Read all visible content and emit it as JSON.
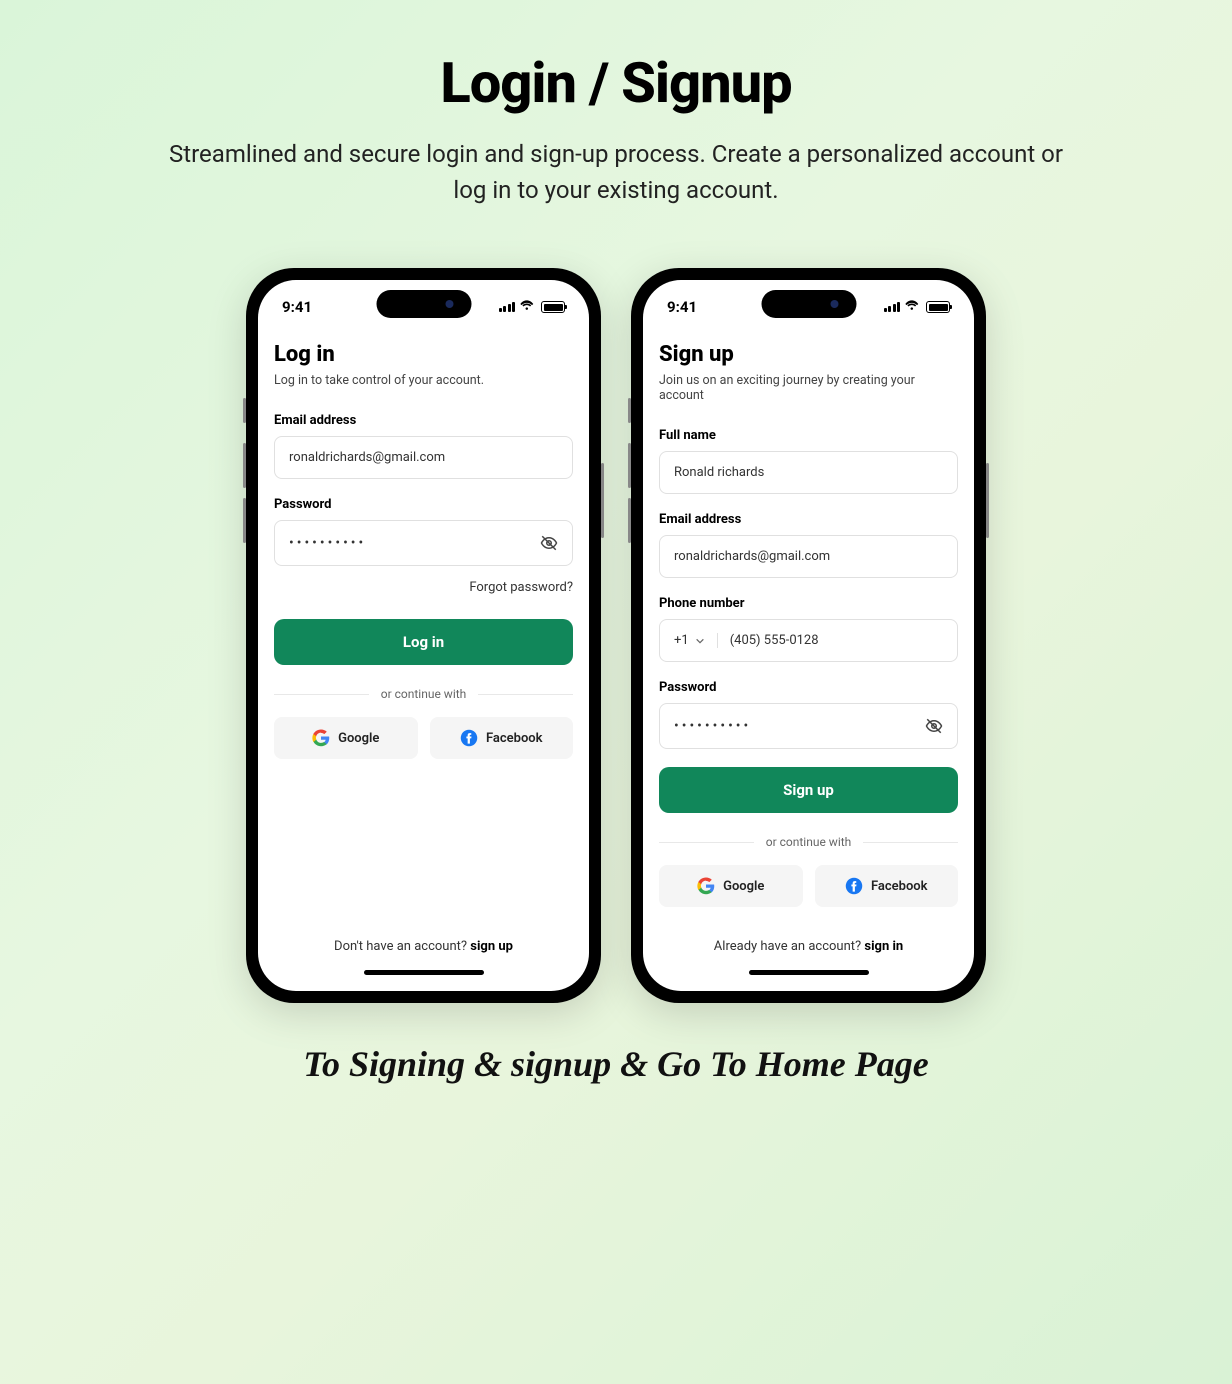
{
  "page": {
    "title": "Login / Signup",
    "subtitle": "Streamlined and secure login and sign-up process. Create a personalized account or log in to your existing account.",
    "footer": "To Signing & signup & Go To Home Page"
  },
  "status": {
    "time": "9:41"
  },
  "login": {
    "title": "Log in",
    "subtitle": "Log in to take control of your account.",
    "email_label": "Email address",
    "email_value": "ronaldrichards@gmail.com",
    "password_label": "Password",
    "password_value": "••••••••••",
    "forgot_password": "Forgot password?",
    "button": "Log in",
    "divider": "or continue with",
    "google": "Google",
    "facebook": "Facebook",
    "prompt": "Don't have an account? ",
    "prompt_link": "sign up"
  },
  "signup": {
    "title": "Sign up",
    "subtitle": "Join us on an exciting journey by creating your account",
    "name_label": "Full name",
    "name_value": "Ronald richards",
    "email_label": "Email address",
    "email_value": "ronaldrichards@gmail.com",
    "phone_label": "Phone number",
    "country_code": "+1",
    "phone_value": "(405) 555-0128",
    "password_label": "Password",
    "password_value": "••••••••••",
    "button": "Sign up",
    "divider": "or continue with",
    "google": "Google",
    "facebook": "Facebook",
    "prompt": "Already have an account? ",
    "prompt_link": "sign in"
  }
}
